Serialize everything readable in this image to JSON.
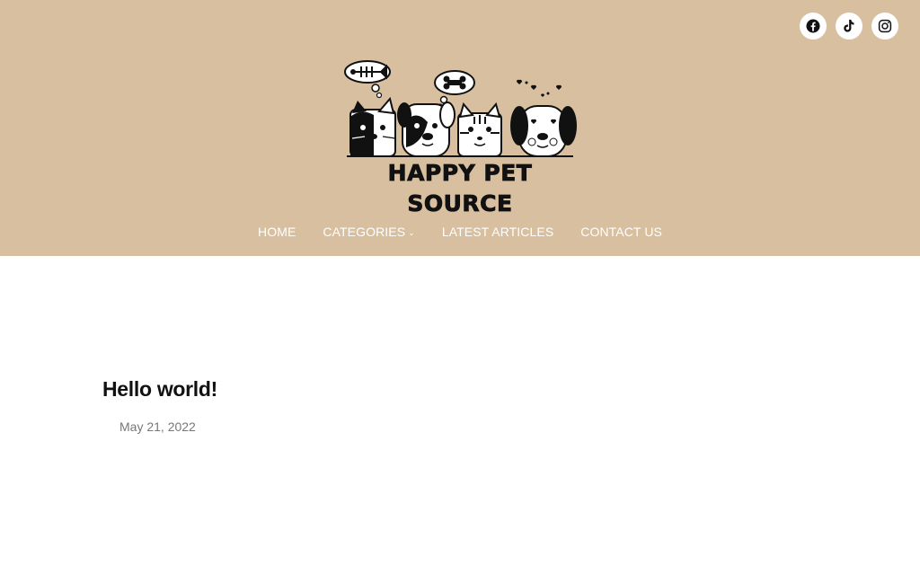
{
  "site": {
    "name": "HAPPY PET SOURCE",
    "header_color": "#d8bf9f"
  },
  "social": [
    {
      "name": "facebook",
      "icon": "facebook-icon"
    },
    {
      "name": "tiktok",
      "icon": "tiktok-icon"
    },
    {
      "name": "instagram",
      "icon": "instagram-icon"
    }
  ],
  "nav": {
    "items": [
      {
        "label": "HOME"
      },
      {
        "label": "CATEGORIES",
        "has_dropdown": true
      },
      {
        "label": "LATEST ARTICLES"
      },
      {
        "label": "CONTACT US"
      }
    ]
  },
  "post": {
    "title": "Hello world!",
    "date": "May 21, 2022"
  }
}
